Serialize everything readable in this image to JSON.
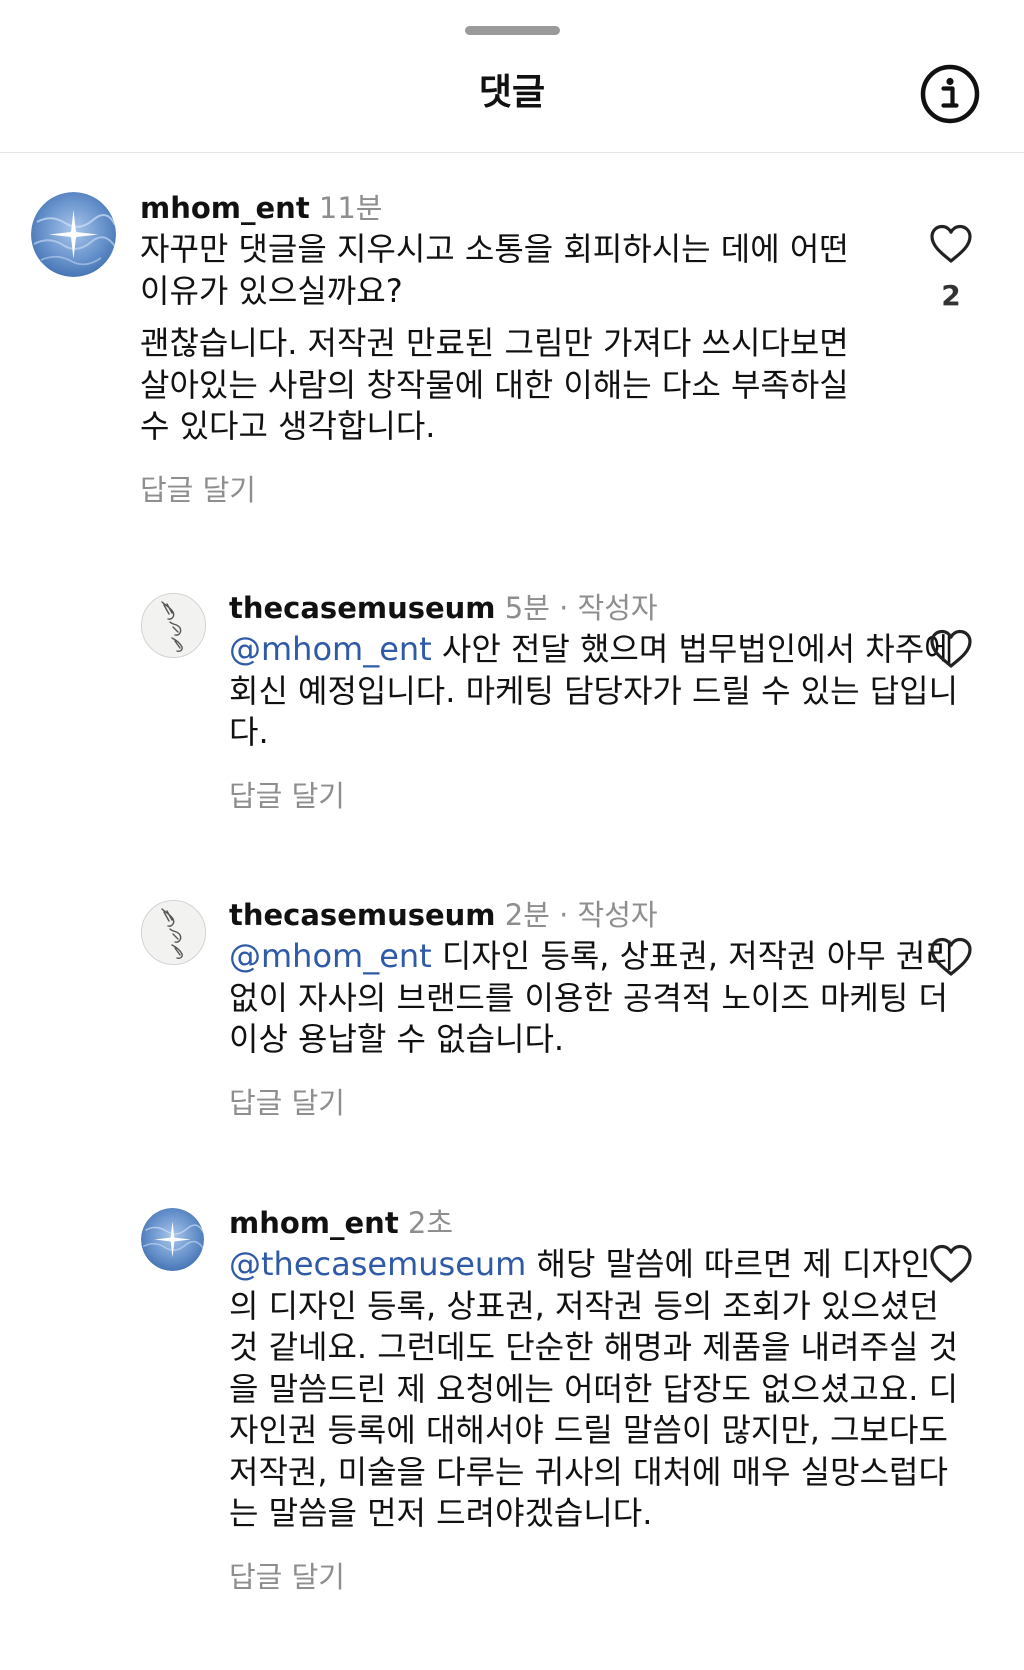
{
  "header": {
    "title": "댓글",
    "info_icon": "info-circle-icon"
  },
  "comments": [
    {
      "username": "mhom_ent",
      "time": "11분",
      "paragraphs": [
        "자꾸만 댓글을 지우시고 소통을 회피하시는 데에 어떤 이유가 있으실까요?",
        "괜찮습니다. 저작권 만료된 그림만 가져다 쓰시다보면 살아있는 사람의 창작물에 대한 이해는 다소 부족하실 수 있다고 생각합니다."
      ],
      "reply_label": "답글 달기",
      "like_count": "2"
    },
    {
      "username": "thecasemuseum",
      "time": "5분",
      "separator": "·",
      "author_badge": "작성자",
      "mention": "@mhom_ent",
      "text": " 사안 전달 했으며 법무법인에서 차주에 회신 예정입니다. 마케팅 담당자가 드릴 수 있는 답입니다.",
      "reply_label": "답글 달기"
    },
    {
      "username": "thecasemuseum",
      "time": "2분",
      "separator": "·",
      "author_badge": "작성자",
      "mention": "@mhom_ent",
      "text": " 디자인 등록, 상표권, 저작권 아무 권리 없이 자사의 브랜드를 이용한 공격적 노이즈 마케팅 더이상 용납할 수 없습니다.",
      "reply_label": "답글 달기"
    },
    {
      "username": "mhom_ent",
      "time": "2초",
      "mention": "@thecasemuseum",
      "text": " 해당 말씀에 따르면 제 디자인의 디자인 등록, 상표권, 저작권 등의 조회가 있으셨던 것 같네요. 그런데도 단순한 해명과 제품을 내려주실 것을 말씀드린 제 요청에는 어떠한 답장도 없으셨고요. 디자인권 등록에 대해서야 드릴 말씀이 많지만, 그보다도 저작권, 미술을 다루는 귀사의 대처에 매우 실망스럽다는 말씀을 먼저 드려야겠습니다.",
      "reply_label": "답글 달기"
    }
  ],
  "icons": {
    "heart": "heart-outline-icon",
    "avatar_mhom": "sparkle-water-avatar",
    "avatar_museum": "hands-sketch-avatar"
  },
  "colors": {
    "mention": "#2f5aa8",
    "secondary_text": "#8e8e8e",
    "avatar_blue": "#6d97cf"
  }
}
